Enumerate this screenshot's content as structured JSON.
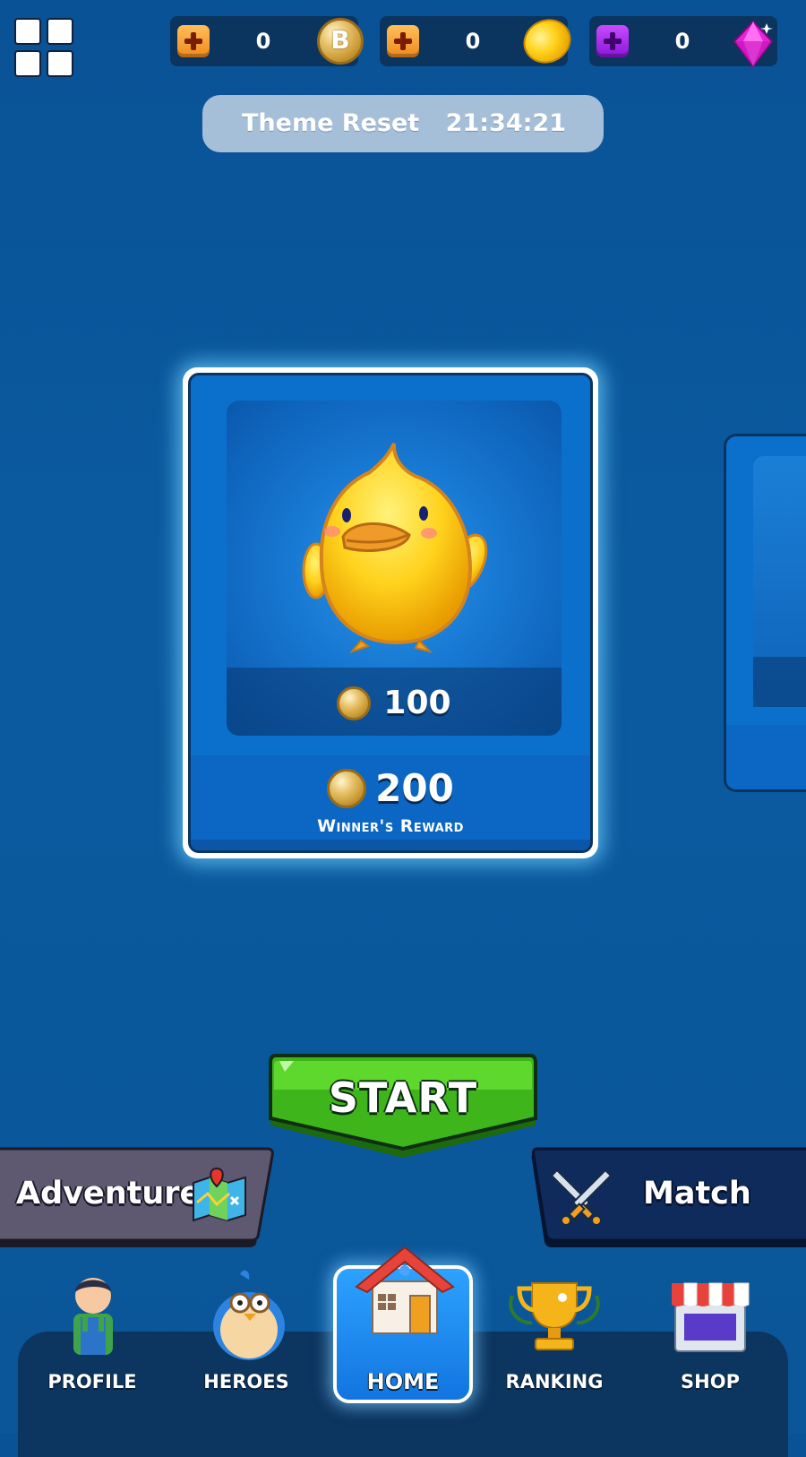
{
  "currencies": [
    {
      "name": "b-token",
      "value": "0"
    },
    {
      "name": "gold-coin",
      "value": "0"
    },
    {
      "name": "gem",
      "value": "0"
    }
  ],
  "theme_reset": {
    "label": "Theme Reset",
    "time": "21:34:21"
  },
  "card": {
    "entry_price": "100",
    "reward_amount": "200",
    "reward_label": "Winner's Reward"
  },
  "buttons": {
    "start": "START",
    "adventure": "Adventure",
    "match": "Match"
  },
  "nav": {
    "profile": "PROFILE",
    "heroes": "HEROES",
    "home": "HOME",
    "ranking": "RANKING",
    "shop": "SHOP"
  },
  "colors": {
    "background": "#0b5aa0",
    "start_green": "#45c21a",
    "adventure_panel": "#5e5870",
    "match_panel": "#0f2b5c",
    "home_active": "#1e8cf0"
  }
}
